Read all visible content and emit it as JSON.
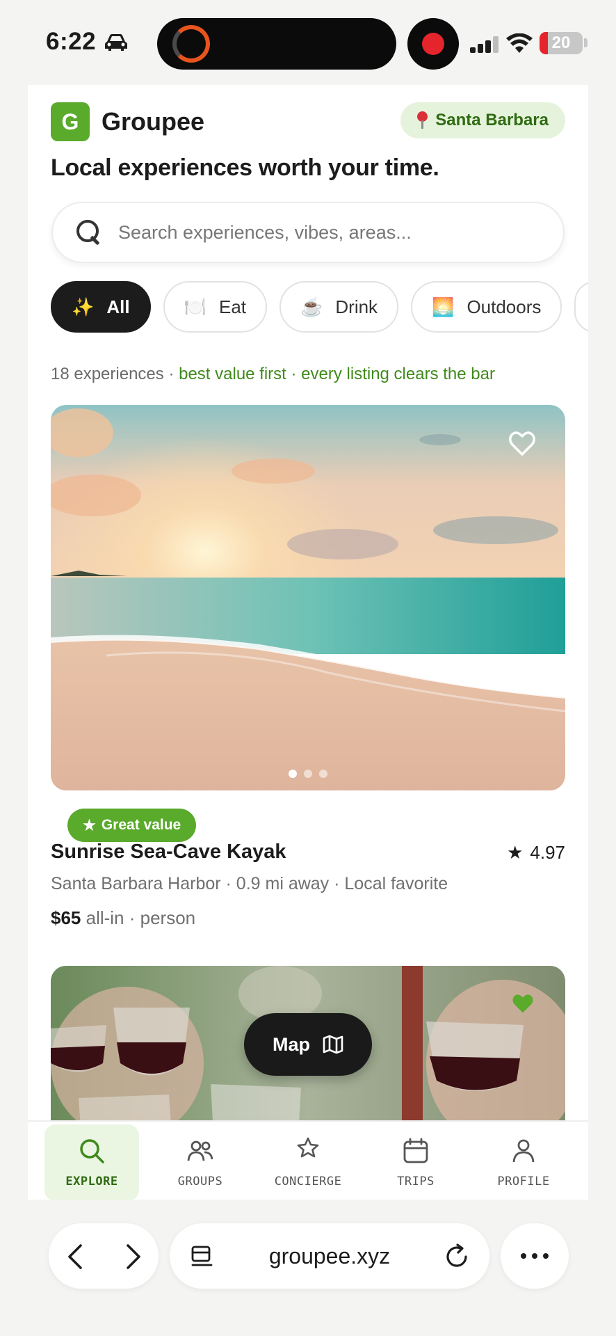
{
  "status_bar": {
    "time": "6:22",
    "battery": "20",
    "battery_level": 0.2,
    "icons": [
      "car-icon",
      "screen-record-icon",
      "cellular-signal-icon",
      "wifi-icon",
      "battery-icon"
    ]
  },
  "header": {
    "logo_letter": "G",
    "brand": "Groupee",
    "location": "Santa Barbara",
    "tagline": "Local experiences worth your time."
  },
  "search": {
    "placeholder": "Search experiences, vibes, areas..."
  },
  "chips": [
    {
      "emoji": "✨",
      "label": "All",
      "active": true
    },
    {
      "emoji": "🍽️",
      "label": "Eat"
    },
    {
      "emoji": "☕",
      "label": "Drink"
    },
    {
      "emoji": "🌅",
      "label": "Outdoors"
    }
  ],
  "meta": {
    "count": "18 experiences",
    "sep": " · ",
    "sort": "best value first · every listing clears the bar"
  },
  "listings": [
    {
      "badge": "Great value",
      "title": "Sunrise Sea-Cave Kayak",
      "rating": "4.97",
      "details": "Santa Barbara Harbor · 0.9 mi away · Local favorite",
      "price": "$65",
      "price_suffix": " all-in · person",
      "saved": false
    },
    {
      "saved": true
    }
  ],
  "map_button": {
    "label": "Map"
  },
  "tabs": [
    {
      "label": "EXPLORE",
      "icon": "search-icon",
      "active": true
    },
    {
      "label": "GROUPS",
      "icon": "groups-icon"
    },
    {
      "label": "CONCIERGE",
      "icon": "star-icon"
    },
    {
      "label": "TRIPS",
      "icon": "calendar-icon"
    },
    {
      "label": "PROFILE",
      "icon": "person-icon"
    }
  ],
  "browser": {
    "url": "groupee.xyz"
  },
  "colors": {
    "brand_green": "#5aaa2b",
    "dark": "#1c1c1c",
    "accent_text_green": "#3f8a1b"
  }
}
